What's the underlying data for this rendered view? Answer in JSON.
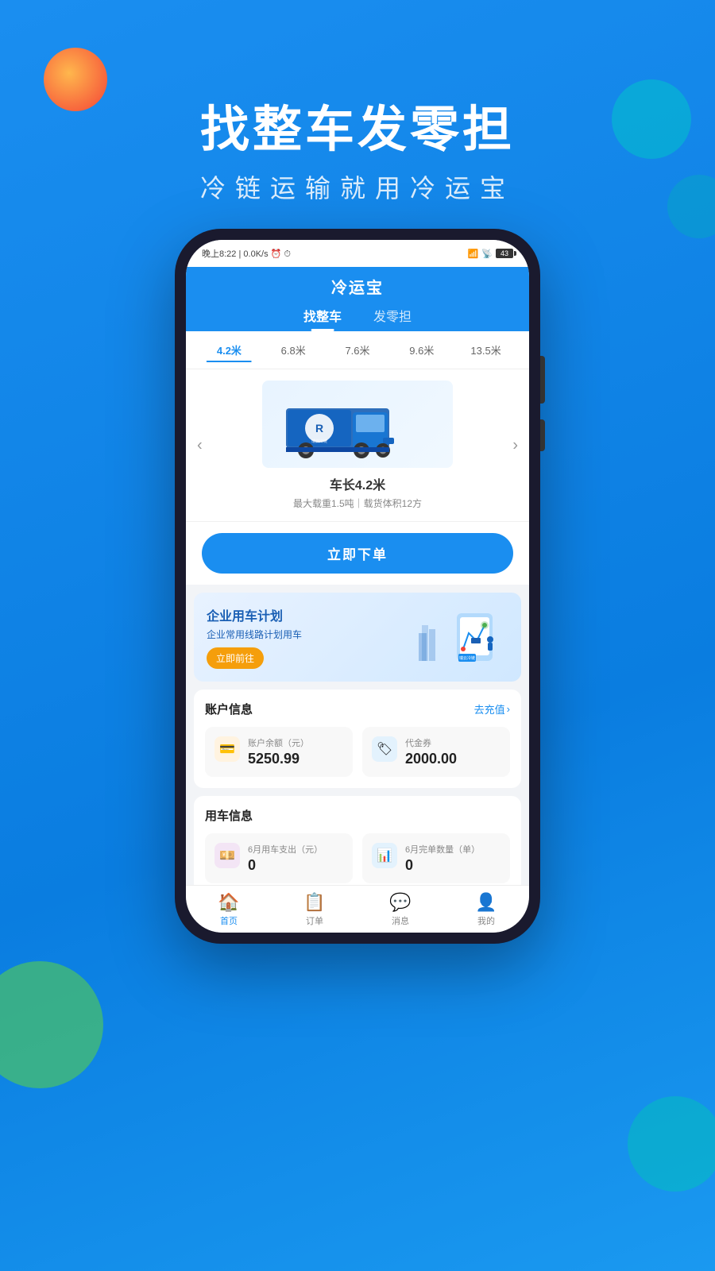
{
  "app": {
    "title": "冷运宝",
    "header_title": "找整车发零担",
    "sub_title": "冷链运输就用冷运宝"
  },
  "status_bar": {
    "time": "晚上8:22",
    "network": "0.0K/s",
    "battery": "43"
  },
  "tabs": [
    {
      "id": "find-truck",
      "label": "找整车",
      "active": true
    },
    {
      "id": "ltl",
      "label": "发零担",
      "active": false
    }
  ],
  "size_tabs": [
    {
      "id": "4.2m",
      "label": "4.2米",
      "active": true
    },
    {
      "id": "6.8m",
      "label": "6.8米",
      "active": false
    },
    {
      "id": "7.6m",
      "label": "7.6米",
      "active": false
    },
    {
      "id": "9.6m",
      "label": "9.6米",
      "active": false
    },
    {
      "id": "13.5m",
      "label": "13.5米",
      "active": false
    }
  ],
  "car_showcase": {
    "name": "车长4.2米",
    "desc": "最大载重1.5吨｜载货体积12方",
    "brand": "瑞云冷链",
    "brand_en": "Ruiyun Cold Chain"
  },
  "order_btn": "立即下单",
  "banner": {
    "title": "企业用车计划",
    "sub": "企业常用线路计划用车",
    "btn_label": "立即前往"
  },
  "account": {
    "section_title": "账户信息",
    "link_label": "去充值",
    "balance_label": "账户余额（元）",
    "balance_value": "5250.99",
    "voucher_label": "代金券",
    "voucher_value": "2000.00"
  },
  "car_usage": {
    "section_title": "用车信息",
    "monthly_cost_label": "6月用车支出（元）",
    "monthly_cost_value": "0",
    "monthly_orders_label": "6月完单数量（单）",
    "monthly_orders_value": "0"
  },
  "bottom_nav": [
    {
      "id": "home",
      "label": "首页",
      "icon": "🏠",
      "active": true
    },
    {
      "id": "orders",
      "label": "订单",
      "icon": "📋",
      "active": false
    },
    {
      "id": "messages",
      "label": "消息",
      "icon": "💬",
      "active": false
    },
    {
      "id": "mine",
      "label": "我的",
      "icon": "👤",
      "active": false
    }
  ]
}
